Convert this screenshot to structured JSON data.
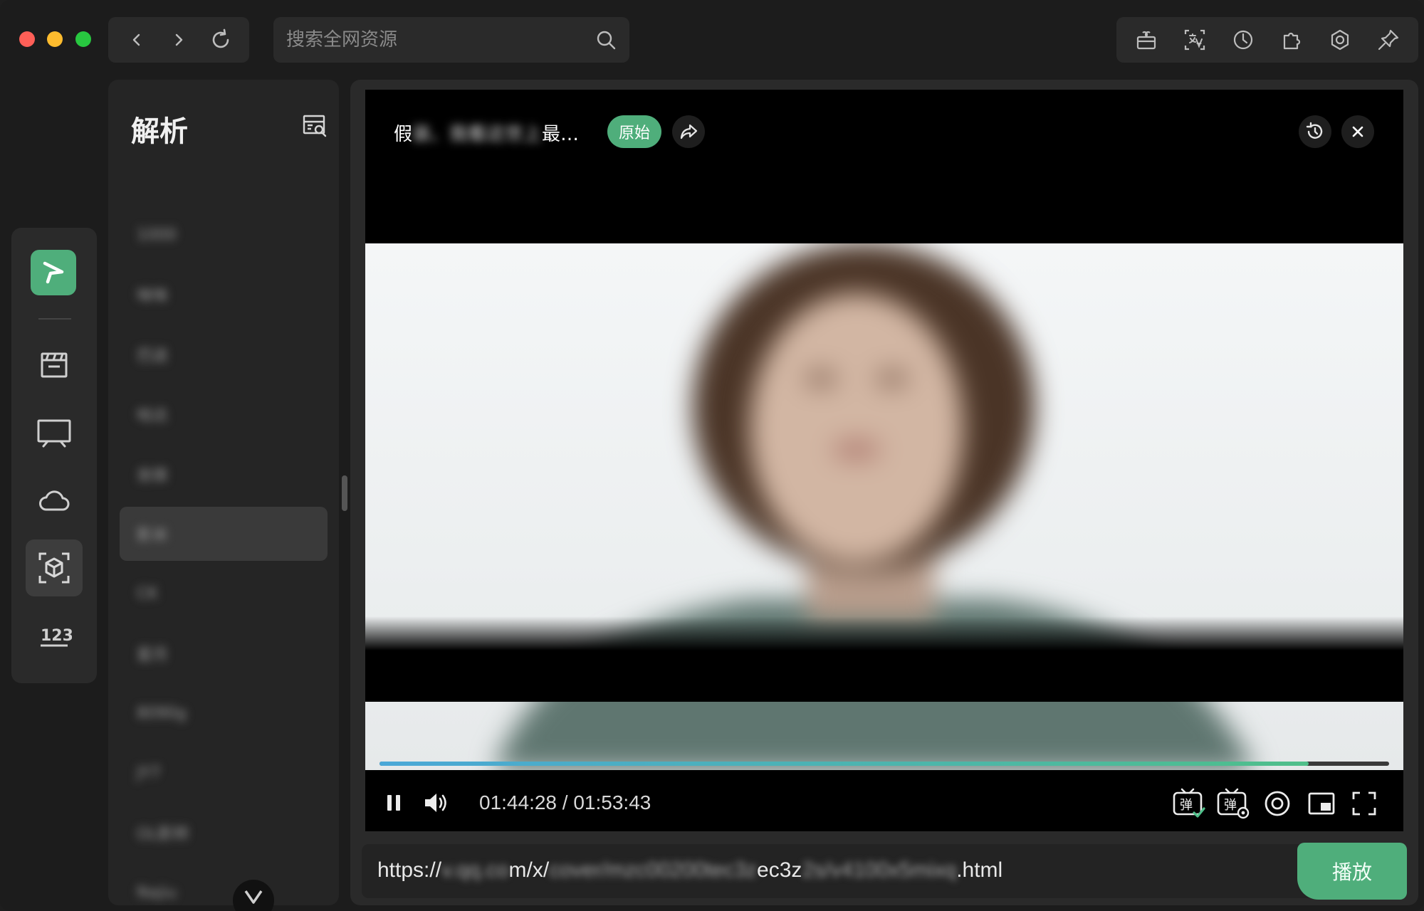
{
  "titlebar": {
    "search_placeholder": "搜索全网资源",
    "nav": [
      "arrow-left-icon",
      "arrow-right-icon",
      "refresh-icon"
    ],
    "tools": [
      "gift-icon",
      "translate-icon",
      "history-icon",
      "puzzle-icon",
      "settings-hex-icon",
      "pin-icon"
    ]
  },
  "rail": {
    "items": [
      "clapperboard-icon",
      "tv-icon",
      "cloud-icon",
      "cube-scan-icon",
      "numbers-123-icon"
    ],
    "active_index": 3
  },
  "panel": {
    "title": "解析",
    "items": [
      "1000",
      "咪咪",
      "巴送",
      "哈达",
      "坐拨",
      "影米",
      "CK",
      "星月",
      "8090g",
      "JY7",
      "OL影转",
      "Najiu"
    ],
    "selected_index": 5
  },
  "player": {
    "title_visible_start": "假",
    "title_blurred": "装、我看这世上",
    "title_visible_end": "最…",
    "badge": "原始",
    "current_time": "01:44:28",
    "time_separator": "/",
    "total_time": "01:53:43",
    "progress_fraction": 0.92,
    "colors": {
      "accent": "#4fae7b",
      "progress_start": "#4aa8d8",
      "progress_end": "#4fbf8a"
    }
  },
  "urlbar": {
    "prefix": "https://",
    "blur1": "v.qq.co",
    "seg1": "m/x/",
    "blur2": "cover/mzc00200tec3z",
    "seg2": "ec3z",
    "blur3": "2s/v4100x5mixq",
    "suffix": ".html",
    "play_label": "播放"
  }
}
